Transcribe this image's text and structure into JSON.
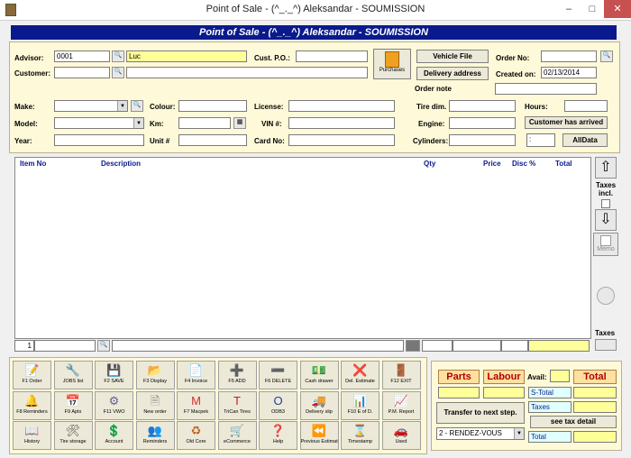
{
  "window": {
    "title": "Point of Sale - (^_._^) Aleksandar - SOUMISSION"
  },
  "banner": "Point of Sale - (^_._^) Aleksandar - SOUMISSION",
  "form": {
    "advisor_label": "Advisor:",
    "advisor_code": "0001",
    "advisor_name": "Luc",
    "customer_label": "Customer:",
    "cust_po_label": "Cust. P.O.:",
    "purchases_label": "Purchases",
    "vehicle_file_label": "Vehicle File",
    "delivery_address_label": "Delivery address",
    "order_no_label": "Order No:",
    "created_on_label": "Created on:",
    "created_on": "02/13/2014",
    "order_note_label": "Order note",
    "make_label": "Make:",
    "colour_label": "Colour:",
    "license_label": "License:",
    "tire_dim_label": "Tire dim.",
    "hours_label": "Hours:",
    "model_label": "Model:",
    "km_label": "Km:",
    "vin_label": "VIN #:",
    "engine_label": "Engine:",
    "customer_arrived_label": "Customer has arrived",
    "year_label": "Year:",
    "unit_label": "Unit #",
    "card_label": "Card No:",
    "cylinders_label": "Cylinders:",
    "time_value": ":",
    "alldata_label": "AllData"
  },
  "grid": {
    "columns": [
      "Item No",
      "Description",
      "Qty",
      "Price",
      "Disc %",
      "Total"
    ],
    "line_number": "1"
  },
  "side": {
    "taxes_incl": "Taxes incl.",
    "memo": "Memo",
    "taxes": "Taxes"
  },
  "toolbar": [
    [
      "F1 Order",
      "JOBS list",
      "F2 SAVE",
      "F3 Display",
      "F4 Invoice",
      "F5 ADD",
      "F6 DELETE",
      "Cash drawer",
      "Del. Estimate",
      "F12 EXIT"
    ],
    [
      "F8 Reminders",
      "F9 Apts",
      "F11 VWO",
      "New order",
      "F7 Macpek",
      "TriCan Tires",
      "ODB3",
      "Delivery slip",
      "F10 E of D.",
      "P.M. Report"
    ],
    [
      "History",
      "Tire storage",
      "Account",
      "Reminders",
      "Old Core",
      "eCommerce",
      "Help",
      "Previous Estimate",
      "Timestamp",
      "Used"
    ]
  ],
  "totals": {
    "parts": "Parts",
    "labour": "Labour",
    "avail": "Avail:",
    "total_hdr": "Total",
    "s_total": "S-Total",
    "taxes": "Taxes",
    "total": "Total",
    "transfer": "Transfer to next step.",
    "see_tax": "see tax detail",
    "status": "2 - RENDEZ-VOUS"
  },
  "colors": {
    "banner": "#0a1a8c",
    "panel": "#fef9d8",
    "highlight": "#ffff99",
    "accent_red": "#b00000"
  }
}
